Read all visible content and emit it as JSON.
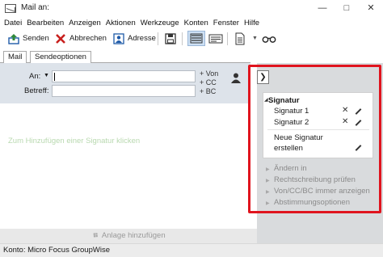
{
  "window": {
    "title": "Mail an:"
  },
  "menu": [
    "Datei",
    "Bearbeiten",
    "Anzeigen",
    "Aktionen",
    "Werkzeuge",
    "Konten",
    "Fenster",
    "Hilfe"
  ],
  "toolbar": {
    "send_label": "Senden",
    "cancel_label": "Abbrechen",
    "address_label": "Adresse"
  },
  "tabs": [
    "Mail",
    "Sendeoptionen"
  ],
  "header": {
    "to_label": "An:",
    "to_value": "",
    "subject_label": "Betreff:",
    "subject_value": "",
    "add_von": "+ Von",
    "add_cc": "+ CC",
    "add_bc": "+ BC"
  },
  "body": {
    "signature_hint": "Zum Hinzufügen einer Signatur klicken"
  },
  "attach": {
    "label": "Anlage hinzufügen"
  },
  "signature_panel": {
    "title": "Signatur",
    "items": [
      "Signatur 1",
      "Signatur 2"
    ],
    "new_line1": "Neue Signatur",
    "new_line2": "erstellen",
    "options": [
      "Ändern in",
      "Rechtschreibung prüfen",
      "Von/CC/BC immer anzeigen",
      "Abstimmungsoptionen"
    ]
  },
  "status": {
    "text": "Konto: Micro Focus GroupWise"
  },
  "colors": {
    "highlight_frame": "#e0141e",
    "header_bg": "#dde3ea",
    "hint_text": "#b9d9b0"
  }
}
